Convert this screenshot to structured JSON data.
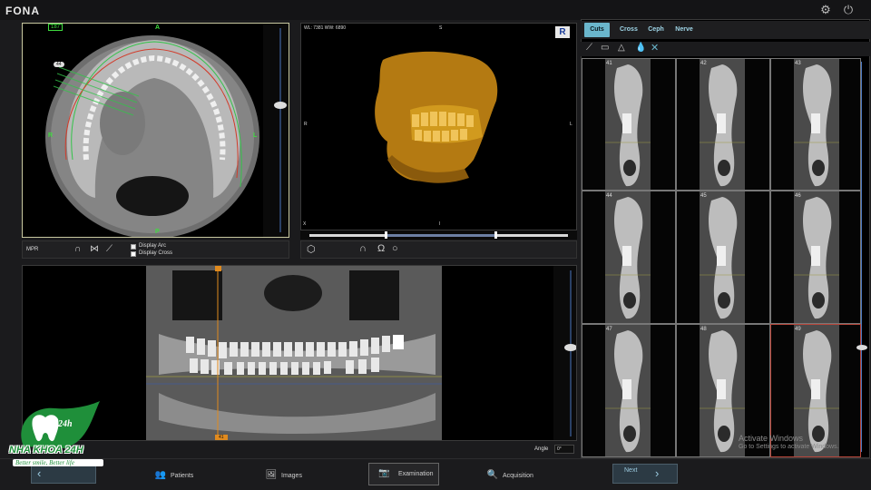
{
  "app": {
    "name": "FONA"
  },
  "axial": {
    "slice_badge": "187",
    "arc_marker": "44",
    "label_top": "A",
    "label_left": "R",
    "label_right": "L",
    "label_bottom": "P"
  },
  "axial_tools": {
    "mpr_label": "MPR",
    "display_arc": "Display Arc",
    "display_cross": "Display Cross",
    "display_arc_checked": true,
    "display_cross_checked": false
  },
  "volume": {
    "wl_ww": "WL: 7381 WW: 6890",
    "badge": "R",
    "label_top": "S",
    "label_left": "R",
    "label_right": "L",
    "label_bottom": "I",
    "label_bottom_left": "X"
  },
  "pano": {
    "cursor_top_label": "",
    "cursor_bottom_label": "41",
    "angle_label": "Angle",
    "angle_value": "0°"
  },
  "cuts": {
    "tabs": [
      "Cuts",
      "Cross",
      "Ceph",
      "Nerve"
    ],
    "active_tab": "Cuts",
    "tools": [
      "ruler-icon",
      "screen-icon",
      "triangle-icon",
      "drop-icon",
      "close-icon"
    ],
    "cells": [
      "41",
      "42",
      "43",
      "44",
      "45",
      "46",
      "47",
      "48",
      "49"
    ]
  },
  "bottom_nav": {
    "patients": "Patients",
    "images": "Images",
    "examination": "Examination",
    "acquisition": "Acquisition",
    "next": "Next"
  },
  "watermark": {
    "title": "Activate Windows",
    "subtitle": "Go to Settings to activate Windows."
  },
  "brand": {
    "name": "NHA KHOA 24H",
    "badge": "24h",
    "slogan": "Better smile, Better life"
  },
  "colors": {
    "accent": "#6ab6cc",
    "brand_green": "#1f8f3a",
    "volume_bone": "#d19a1e",
    "arc_green": "#34c34a",
    "arc_red": "#d23b2a"
  }
}
